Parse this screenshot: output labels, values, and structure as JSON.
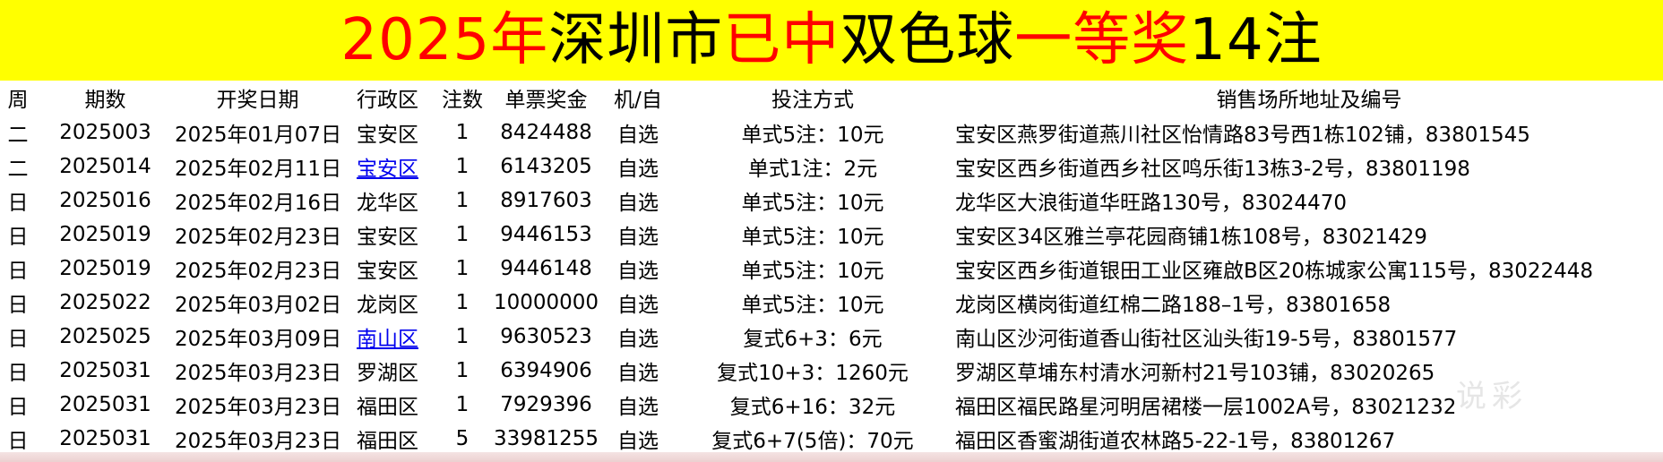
{
  "title": {
    "year": "2025年",
    "city": "深圳市",
    "won": "已中",
    "game": "双色球",
    "prize": "一等奖",
    "count": "14注"
  },
  "headers": [
    "周",
    "期数",
    "开奖日期",
    "行政区",
    "注数",
    "单票奖金",
    "机/自",
    "投注方式",
    "销售场所地址及编号"
  ],
  "rows": [
    {
      "week": "二",
      "issue": "2025003",
      "date": "2025年01月07日",
      "district": "宝安区",
      "notes": "1",
      "prize": "8424488",
      "pick": "自选",
      "method": "单式5注：10元",
      "address": "宝安区燕罗街道燕川社区怡情路83号西1栋102铺，83801545"
    },
    {
      "week": "二",
      "issue": "2025014",
      "date": "2025年02月11日",
      "district": "宝安区",
      "notes": "1",
      "prize": "6143205",
      "pick": "自选",
      "method": "单式1注：2元",
      "address": "宝安区西乡街道西乡社区鸣乐街13栋3-2号，83801198"
    },
    {
      "week": "日",
      "issue": "2025016",
      "date": "2025年02月16日",
      "district": "龙华区",
      "notes": "1",
      "prize": "8917603",
      "pick": "自选",
      "method": "单式5注：10元",
      "address": "龙华区大浪街道华旺路130号，83024470"
    },
    {
      "week": "日",
      "issue": "2025019",
      "date": "2025年02月23日",
      "district": "宝安区",
      "notes": "1",
      "prize": "9446153",
      "pick": "自选",
      "method": "单式5注：10元",
      "address": "宝安区34区雅兰亭花园商铺1栋108号，83021429"
    },
    {
      "week": "日",
      "issue": "2025019",
      "date": "2025年02月23日",
      "district": "宝安区",
      "notes": "1",
      "prize": "9446148",
      "pick": "自选",
      "method": "单式5注：10元",
      "address": "宝安区西乡街道银田工业区雍啟B区20栋城家公寓115号，83022448"
    },
    {
      "week": "日",
      "issue": "2025022",
      "date": "2025年03月02日",
      "district": "龙岗区",
      "notes": "1",
      "prize": "10000000",
      "pick": "自选",
      "method": "单式5注：10元",
      "address": "龙岗区横岗街道红棉二路188–1号，83801658"
    },
    {
      "week": "日",
      "issue": "2025025",
      "date": "2025年03月09日",
      "district": "南山区",
      "notes": "1",
      "prize": "9630523",
      "pick": "自选",
      "method": "复式6+3：6元",
      "address": "南山区沙河街道香山街社区汕头街19-5号，83801577"
    },
    {
      "week": "日",
      "issue": "2025031",
      "date": "2025年03月23日",
      "district": "罗湖区",
      "notes": "1",
      "prize": "6394906",
      "pick": "自选",
      "method": "复式10+3：1260元",
      "address": "罗湖区草埔东村清水河新村21号103铺，83020265"
    },
    {
      "week": "日",
      "issue": "2025031",
      "date": "2025年03月23日",
      "district": "福田区",
      "notes": "1",
      "prize": "7929396",
      "pick": "自选",
      "method": "复式6+16：32元",
      "address": "福田区福民路星河明居裙楼一层1002A号，83021232"
    },
    {
      "week": "日",
      "issue": "2025031",
      "date": "2025年03月23日",
      "district": "福田区",
      "notes": "5",
      "prize": "33981255",
      "pick": "自选",
      "method": "复式6+7(5倍)：70元",
      "address": "福田区香蜜湖街道农林路5-22-1号，83801267"
    }
  ],
  "links": [
    1,
    6
  ],
  "watermark": "说彩"
}
